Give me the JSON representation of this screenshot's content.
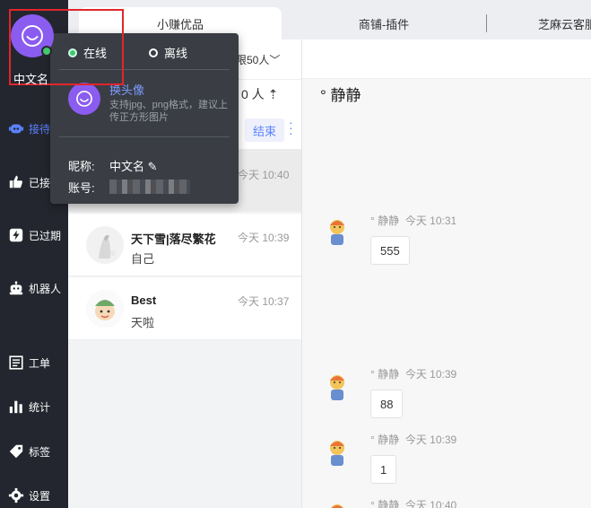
{
  "user": {
    "name": "中文名",
    "status": "online"
  },
  "sidebar": {
    "items": [
      {
        "label": "接待",
        "icon": "robot-chat-icon",
        "active": true
      },
      {
        "label": "已接",
        "icon": "thumbs-up-icon"
      },
      {
        "label": "已过期",
        "icon": "lightning-icon"
      },
      {
        "label": "机器人",
        "icon": "robot-icon"
      },
      {
        "label": "工单",
        "icon": "ticket-icon"
      },
      {
        "label": "统计",
        "icon": "bar-chart-icon"
      },
      {
        "label": "标签",
        "icon": "tag-icon"
      },
      {
        "label": "设置",
        "icon": "gear-icon"
      }
    ]
  },
  "tabs": [
    {
      "label": "小赚优品",
      "active": true
    },
    {
      "label": "商铺-插件"
    },
    {
      "label": "芝麻云客服"
    }
  ],
  "conversation_list": {
    "limit_text": "限50人",
    "count_text": "0 人",
    "end_label": "结束",
    "items": [
      {
        "name": "天下雪|落尽繁花",
        "message": "自己",
        "time": "今天 10:39"
      },
      {
        "name": "Best",
        "message": "天啦",
        "time": "今天 10:37"
      }
    ],
    "selected_time": "今天 10:40"
  },
  "chat": {
    "title": "° 静静",
    "messages": [
      {
        "sender": "° 静静",
        "time": "今天 10:31",
        "text": "555"
      },
      {
        "sender": "° 静静",
        "time": "今天 10:39",
        "text": "88"
      },
      {
        "sender": "° 静静",
        "time": "今天 10:39",
        "text": "1"
      },
      {
        "sender": "° 静静",
        "time": "今天 10:40",
        "text": ""
      }
    ]
  },
  "popup": {
    "online_label": "在线",
    "offline_label": "离线",
    "change_avatar": "换头像",
    "hint": "支持jpg、png格式，建议上传正方形图片",
    "nickname_label": "昵称:",
    "nickname_value": "中文名",
    "account_label": "账号:"
  },
  "colors": {
    "accent": "#5b82ff",
    "avatar_purple": "#8a5cf0",
    "online_green": "#44c76a",
    "sidebar_bg": "#23262e",
    "highlight_red": "#e0262c"
  }
}
